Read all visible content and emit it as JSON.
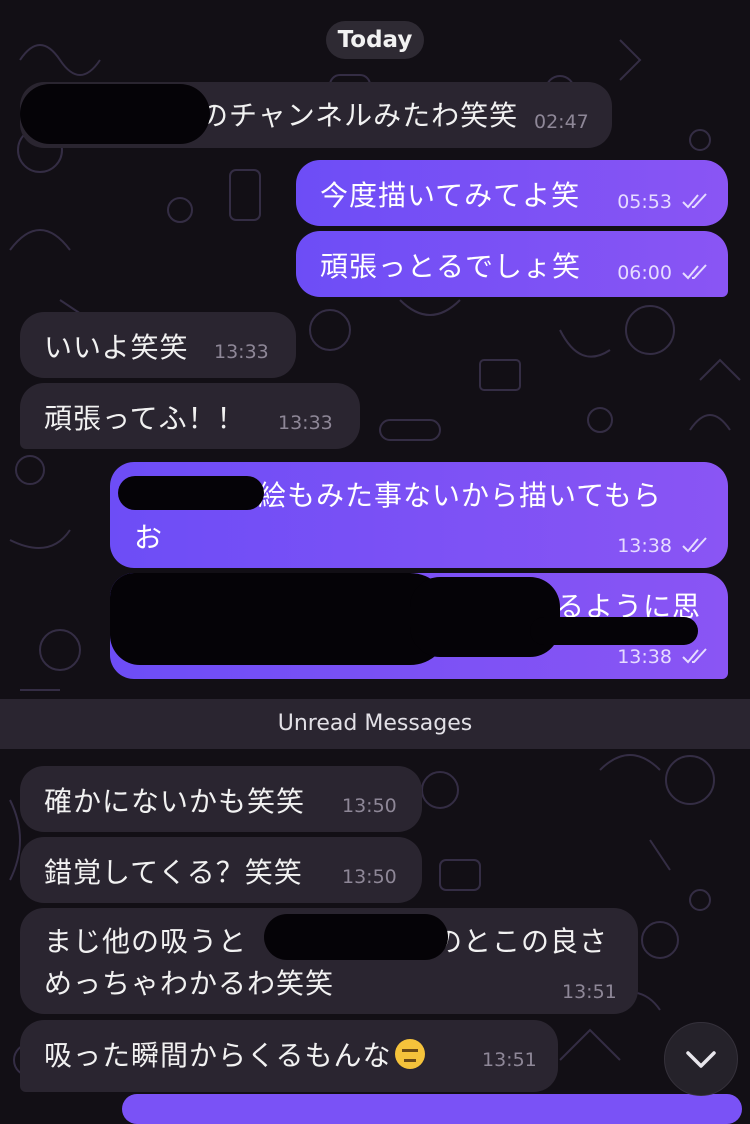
{
  "date_divider": "Today",
  "unread_divider": "Unread Messages",
  "messages": [
    {
      "text": "のチャンネルみたわ笑笑",
      "time": "02:47"
    },
    {
      "text": "今度描いてみてよ笑",
      "time": "05:53"
    },
    {
      "text": "頑張っとるでしょ笑",
      "time": "06:00"
    },
    {
      "text": "いいよ笑笑",
      "time": "13:33"
    },
    {
      "text": "頑張ってふ！！",
      "time": "13:33"
    },
    {
      "line1": "絵もみた事ないから描いてもら",
      "line2": "お",
      "time": "13:38"
    },
    {
      "text": "るように思",
      "time": "13:38"
    },
    {
      "text": "確かにないかも笑笑",
      "time": "13:50"
    },
    {
      "text": "錯覚してくる？笑笑",
      "time": "13:50"
    },
    {
      "line1a": "まじ他の吸うと",
      "line1b": "のとこの良さ",
      "line2": "めっちゃわかるわ笑笑",
      "time": "13:51"
    },
    {
      "text": "吸った瞬間からくるもんな",
      "time": "13:51"
    }
  ],
  "icons": {
    "read_receipt": "double-check-icon",
    "scroll_down": "chevron-down-icon",
    "emoji": "expressionless-face-emoji"
  },
  "colors": {
    "background": "#120f15",
    "incoming_bubble": "#2a2530",
    "outgoing_bubble": "#7a52f6"
  }
}
